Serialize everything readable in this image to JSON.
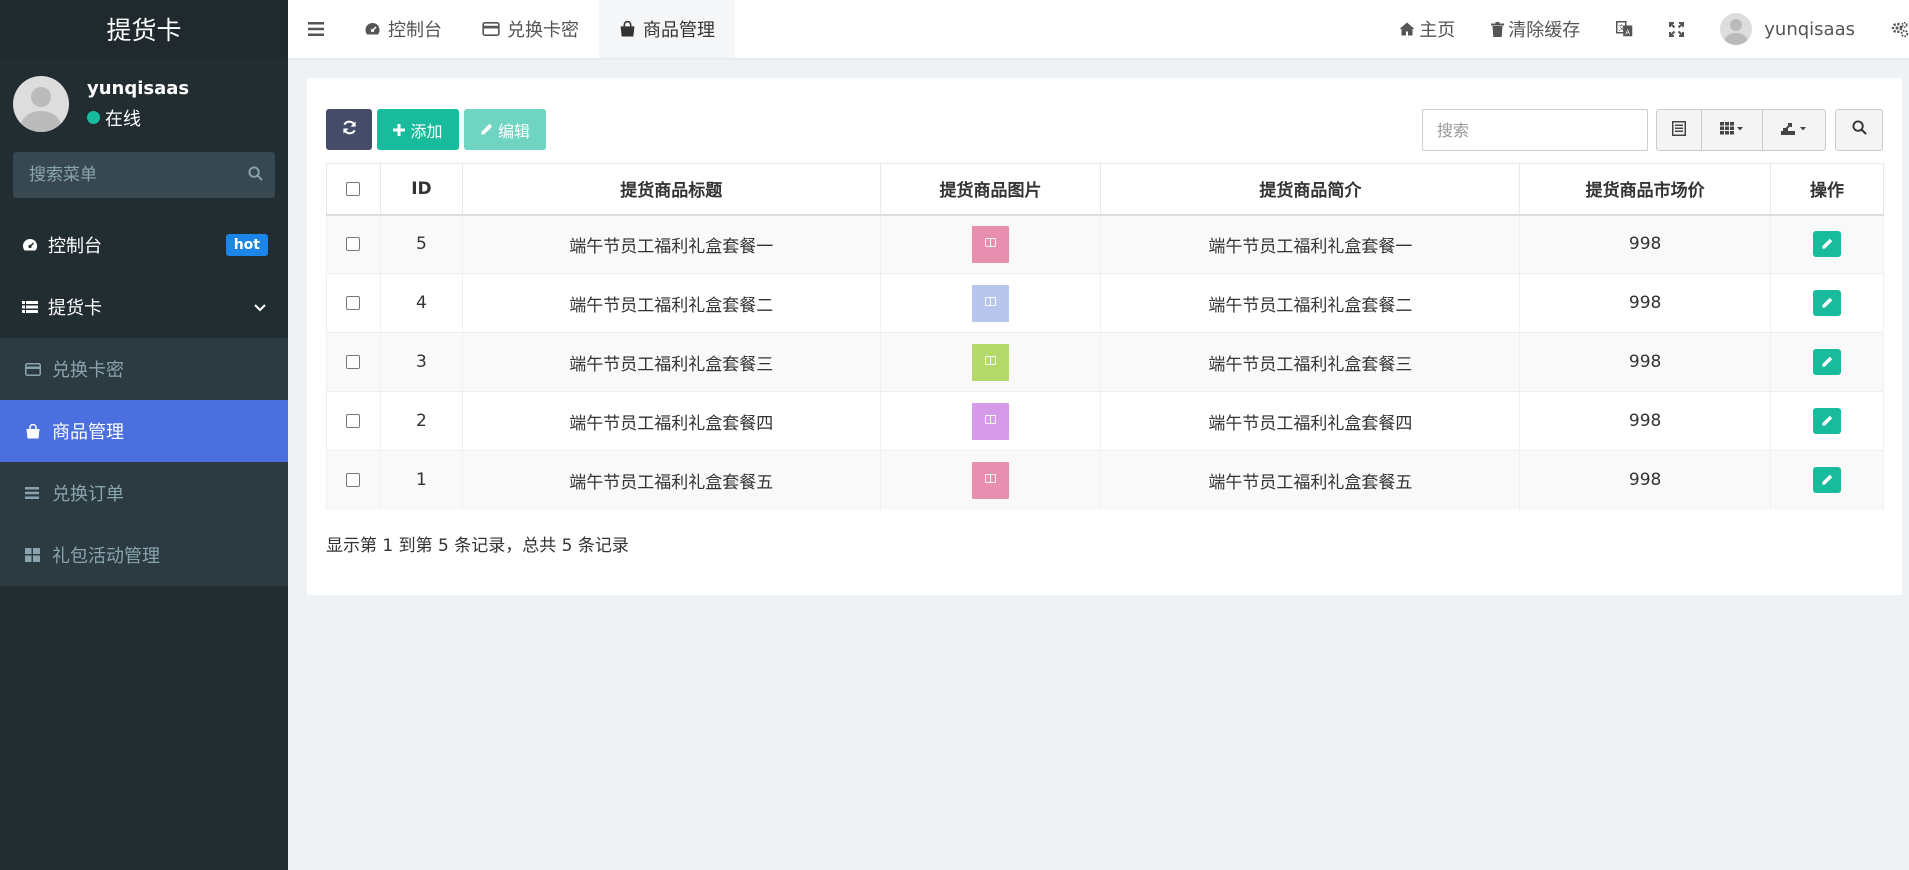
{
  "sidebar": {
    "brand": "提货卡",
    "user": {
      "name": "yunqisaas",
      "status": "在线"
    },
    "search_placeholder": "搜索菜单",
    "items": [
      {
        "label": "控制台",
        "icon": "dashboard-icon",
        "badge": "hot"
      },
      {
        "label": "提货卡",
        "icon": "list-icon",
        "expanded": true
      }
    ],
    "subitems": [
      {
        "label": "兑换卡密",
        "icon": "credit-card-icon",
        "active": false
      },
      {
        "label": "商品管理",
        "icon": "shopping-bag-icon",
        "active": true
      },
      {
        "label": "兑换订单",
        "icon": "bars-icon",
        "active": false
      },
      {
        "label": "礼包活动管理",
        "icon": "grid-icon",
        "active": false
      }
    ]
  },
  "header": {
    "tabs": [
      {
        "label": "控制台",
        "icon": "dashboard-icon"
      },
      {
        "label": "兑换卡密",
        "icon": "credit-card-icon"
      },
      {
        "label": "商品管理",
        "icon": "shopping-bag-icon",
        "active": true
      }
    ],
    "home_label": "主页",
    "clear_cache_label": "清除缓存",
    "username": "yunqisaas"
  },
  "toolbar": {
    "add_label": "添加",
    "edit_label": "编辑",
    "search_placeholder": "搜索"
  },
  "table": {
    "columns": [
      "ID",
      "提货商品标题",
      "提货商品图片",
      "提货商品简介",
      "提货商品市场价",
      "操作"
    ],
    "rows": [
      {
        "id": "5",
        "title": "端午节员工福利礼盒套餐一",
        "image_color": "#e88fb0",
        "intro": "端午节员工福利礼盒套餐一",
        "price": "998"
      },
      {
        "id": "4",
        "title": "端午节员工福利礼盒套餐二",
        "image_color": "#b8c6ee",
        "intro": "端午节员工福利礼盒套餐二",
        "price": "998"
      },
      {
        "id": "3",
        "title": "端午节员工福利礼盒套餐三",
        "image_color": "#b5d86a",
        "intro": "端午节员工福利礼盒套餐三",
        "price": "998"
      },
      {
        "id": "2",
        "title": "端午节员工福利礼盒套餐四",
        "image_color": "#d59be8",
        "intro": "端午节员工福利礼盒套餐四",
        "price": "998"
      },
      {
        "id": "1",
        "title": "端午节员工福利礼盒套餐五",
        "image_color": "#e88fb0",
        "intro": "端午节员工福利礼盒套餐五",
        "price": "998"
      }
    ]
  },
  "pagination": {
    "info": "显示第 1 到第 5 条记录，总共 5 条记录"
  },
  "colors": {
    "accent": "#4c6fe0",
    "success": "#18bc9c",
    "sidebar_bg": "#222d32",
    "badge": "#1c85e8"
  }
}
